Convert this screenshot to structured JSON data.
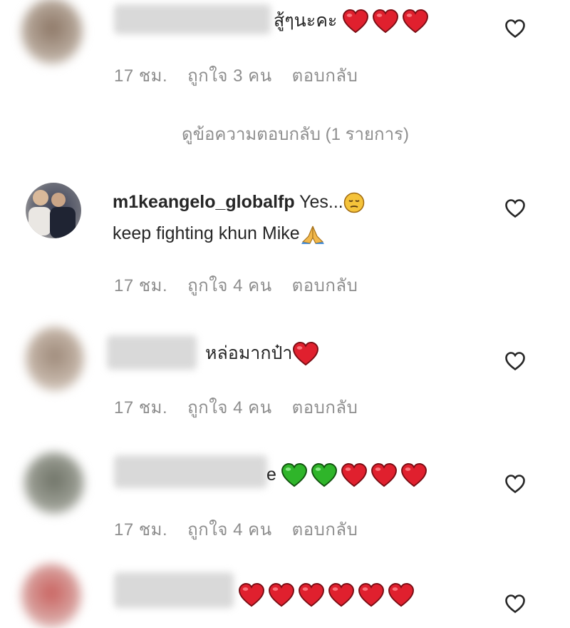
{
  "comments": [
    {
      "text": "สู้ๆนะคะ",
      "meta": {
        "time": "17 ชม.",
        "likes": "ถูกใจ 3 คน",
        "reply": "ตอบกลับ"
      }
    },
    {
      "username": "m1keangelo_globalfp",
      "text_line1": "Yes...",
      "text_line2": "keep fighting khun Mike",
      "meta": {
        "time": "17 ชม.",
        "likes": "ถูกใจ 4 คน",
        "reply": "ตอบกลับ"
      }
    },
    {
      "text": "หล่อมากป๋า",
      "meta": {
        "time": "17 ชม.",
        "likes": "ถูกใจ 4 คน",
        "reply": "ตอบกลับ"
      }
    },
    {
      "text": "e",
      "meta": {
        "time": "17 ชม.",
        "likes": "ถูกใจ 4 คน",
        "reply": "ตอบกลับ"
      }
    },
    {
      "text": ""
    }
  ],
  "view_replies": "ดูข้อความตอบกลับ (1 รายการ)",
  "colors": {
    "heart_red": "#e0202e",
    "heart_green": "#2fb52a",
    "meta_gray": "#8e8e8e"
  }
}
